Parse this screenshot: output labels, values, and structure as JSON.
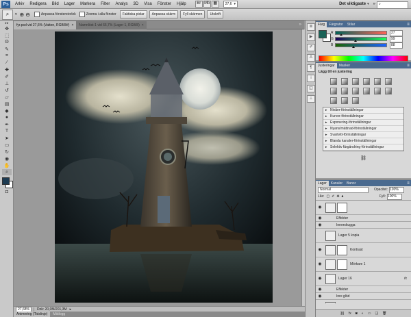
{
  "menubar": {
    "logo": "Ps",
    "items": [
      "Arkiv",
      "Redigera",
      "Bild",
      "Lager",
      "Markera",
      "Filter",
      "Analys",
      "3D",
      "Visa",
      "Fönster",
      "Hjälp"
    ],
    "zoom": "27,6",
    "workspace": "Det viktigaste",
    "buttons": {
      "min": "–",
      "max": "□",
      "close": "×"
    }
  },
  "options": {
    "resize_windows_label": "Anpassa fönsterstorlek",
    "zoom_all_label": "Zooma i alla fönster",
    "actual_pixels": "Faktiska pixlar",
    "fit_screen": "Anpassa skärm",
    "fill_screen": "Fyll skärmen",
    "print_size": "Utskrift"
  },
  "tabs": [
    {
      "label": "fyr.psd vid 27,6% (Vatten, RGB/8#)",
      "active": true
    },
    {
      "label": "Namnlöst-1 vid 66,7% (Lager 1, RGB/8)",
      "active": false
    }
  ],
  "status": {
    "zoom": "27,68%",
    "doc": "Dok: 20,0M/201,3M"
  },
  "bottom_tabs": [
    "Animering (Tidslinje)",
    "Mätlogg"
  ],
  "color_panel": {
    "tabs": [
      "Färg",
      "Färgrutor",
      "Stilar"
    ],
    "sliders": [
      {
        "label": "R",
        "value": "27",
        "pos": 0.11
      },
      {
        "label": "G",
        "value": "99",
        "pos": 0.39
      },
      {
        "label": "B",
        "value": "88",
        "pos": 0.35
      }
    ],
    "fg_color": "#1b6358",
    "bg_color": "#ffffff"
  },
  "adjustments": {
    "tabs": [
      "Justeringar",
      "Masker"
    ],
    "title": "Lägg till en justering",
    "presets": [
      "Nivåer-förinställningar",
      "Kurvor-förinställningar",
      "Exponering-förinställningar",
      "Nyans/mättnad-förinställningar",
      "Svartvitt-förinställningar",
      "Blanda kanaler-förinställningar",
      "Selektiv färgändring-förinställningar"
    ]
  },
  "layers_panel": {
    "tabs": [
      "Lager",
      "Kanaler",
      "Banor"
    ],
    "blend_mode": "Normal",
    "opacity_label": "Opacitet:",
    "opacity": "100%",
    "lock_label": "Lås:",
    "fill_label": "Fyll:",
    "fill": "100%",
    "layers": [
      {
        "type": "layer",
        "name": "",
        "visible": true,
        "mask": true
      },
      {
        "type": "sub",
        "name": "Effekter"
      },
      {
        "type": "sub",
        "name": "Innerskugga"
      },
      {
        "type": "layer",
        "name": "Lager 5 kopia",
        "visible": false,
        "mask": false
      },
      {
        "type": "layer",
        "name": "Kontrast",
        "visible": true,
        "mask": true
      },
      {
        "type": "layer",
        "name": "Mörkare 1",
        "visible": true,
        "mask": true
      },
      {
        "type": "layer",
        "name": "Lager 16",
        "visible": true,
        "mask": false,
        "fx": "fx"
      },
      {
        "type": "sub",
        "name": "Effekter"
      },
      {
        "type": "sub",
        "name": "Inre glöd"
      },
      {
        "type": "layer",
        "name": "Fåglar",
        "visible": true,
        "mask": false
      },
      {
        "type": "layer",
        "name": "MOT",
        "visible": true,
        "mask": false
      }
    ]
  }
}
